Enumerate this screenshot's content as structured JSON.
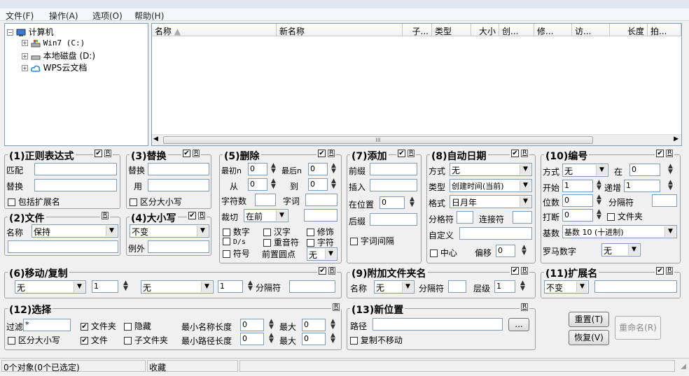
{
  "menu": {
    "file": "文件(F)",
    "ops": "操作(A)",
    "options": "选项(O)",
    "help": "帮助(H)"
  },
  "tree": {
    "root": "计算机",
    "items": [
      "Win7 (C:)",
      "本地磁盘 (D:)",
      "WPS云文档"
    ]
  },
  "list": {
    "columns": [
      "名称",
      "新名称",
      "子...",
      "类型",
      "大小",
      "创...",
      "修...",
      "访...",
      "长度",
      "拍..."
    ],
    "scroll_glyph": "III"
  },
  "r": "R",
  "g1": {
    "title": "(1)正则表达式",
    "match": "匹配",
    "replace": "替换",
    "ext": "包括扩展名"
  },
  "g2": {
    "title": "(2)文件",
    "name_lbl": "名称",
    "name_val": "保持"
  },
  "g3": {
    "title": "(3)替换",
    "replace": "替换",
    "with": "用",
    "case": "区分大小写"
  },
  "g4": {
    "title": "(4)大小写",
    "mode": "不变",
    "except": "例外"
  },
  "g5": {
    "title": "(5)删除",
    "first": "最初n",
    "first_val": "0",
    "last": "最后n",
    "last_val": "0",
    "from": "从",
    "from_val": "0",
    "to": "到",
    "to_val": "0",
    "chars": "字符数",
    "words": "字词",
    "crop": "裁切",
    "crop_val": "在前",
    "digits": "数字",
    "han": "汉字",
    "trim": "修饰",
    "ds": "D/s",
    "dup": "重音符",
    "charlbl": "字符",
    "sym": "符号",
    "lead": "前置圆点",
    "lead_val": "无"
  },
  "g6": {
    "title": "(6)移动/复制",
    "sel1": "无",
    "n1": "1",
    "sel2": "无",
    "n2": "1",
    "sep": "分隔符"
  },
  "g7": {
    "title": "(7)添加",
    "prefix": "前缀",
    "insert": "插入",
    "at": "在位置",
    "at_val": "0",
    "suffix": "后缀",
    "wordsp": "字词间隔"
  },
  "g8": {
    "title": "(8)自动日期",
    "mode": "方式",
    "mode_val": "无",
    "type": "类型",
    "type_val": "创建时间(当前)",
    "fmt": "格式",
    "fmt_val": "日月年",
    "sep": "分格符",
    "join": "连接符",
    "custom": "自定义",
    "center": "中心",
    "offset": "偏移",
    "offset_val": "0"
  },
  "g9": {
    "title": "(9)附加文件夹名",
    "name": "名称",
    "name_val": "无",
    "sep": "分隔符",
    "level": "层级",
    "level_val": "1"
  },
  "g10": {
    "title": "(10)编号",
    "mode": "方式",
    "mode_val": "无",
    "at": "在",
    "at_val": "0",
    "start": "开始",
    "start_val": "1",
    "step": "递增",
    "step_val": "1",
    "pad": "位数",
    "pad_val": "0",
    "sep": "分隔符",
    "break": "打断",
    "break_val": "0",
    "folder": "文件夹",
    "base": "基数",
    "base_val": "基数 10 (十进制)",
    "roman": "罗马数字",
    "roman_val": "无"
  },
  "g11": {
    "title": "(11)扩展名",
    "mode_val": "不变"
  },
  "g12": {
    "title": "(12)选择",
    "filter": "过滤",
    "filter_val": "*",
    "folder": "文件夹",
    "hidden": "隐藏",
    "minname": "最小名称长度",
    "minname_val": "0",
    "max1": "最大",
    "max1_val": "0",
    "case": "区分大小写",
    "file": "文件",
    "subfolder": "子文件夹",
    "minpath": "最小路径长度",
    "minpath_val": "0",
    "max2": "最大",
    "max2_val": "0"
  },
  "g13": {
    "title": "(13)新位置",
    "path": "路径",
    "browse": "...",
    "copy": "复制不移动"
  },
  "buttons": {
    "reset": "重置(T)",
    "undo": "恢复(V)",
    "rename": "重命名(R)"
  },
  "status": {
    "objects": "0个对象(0个已选定)",
    "fav": "收藏"
  }
}
